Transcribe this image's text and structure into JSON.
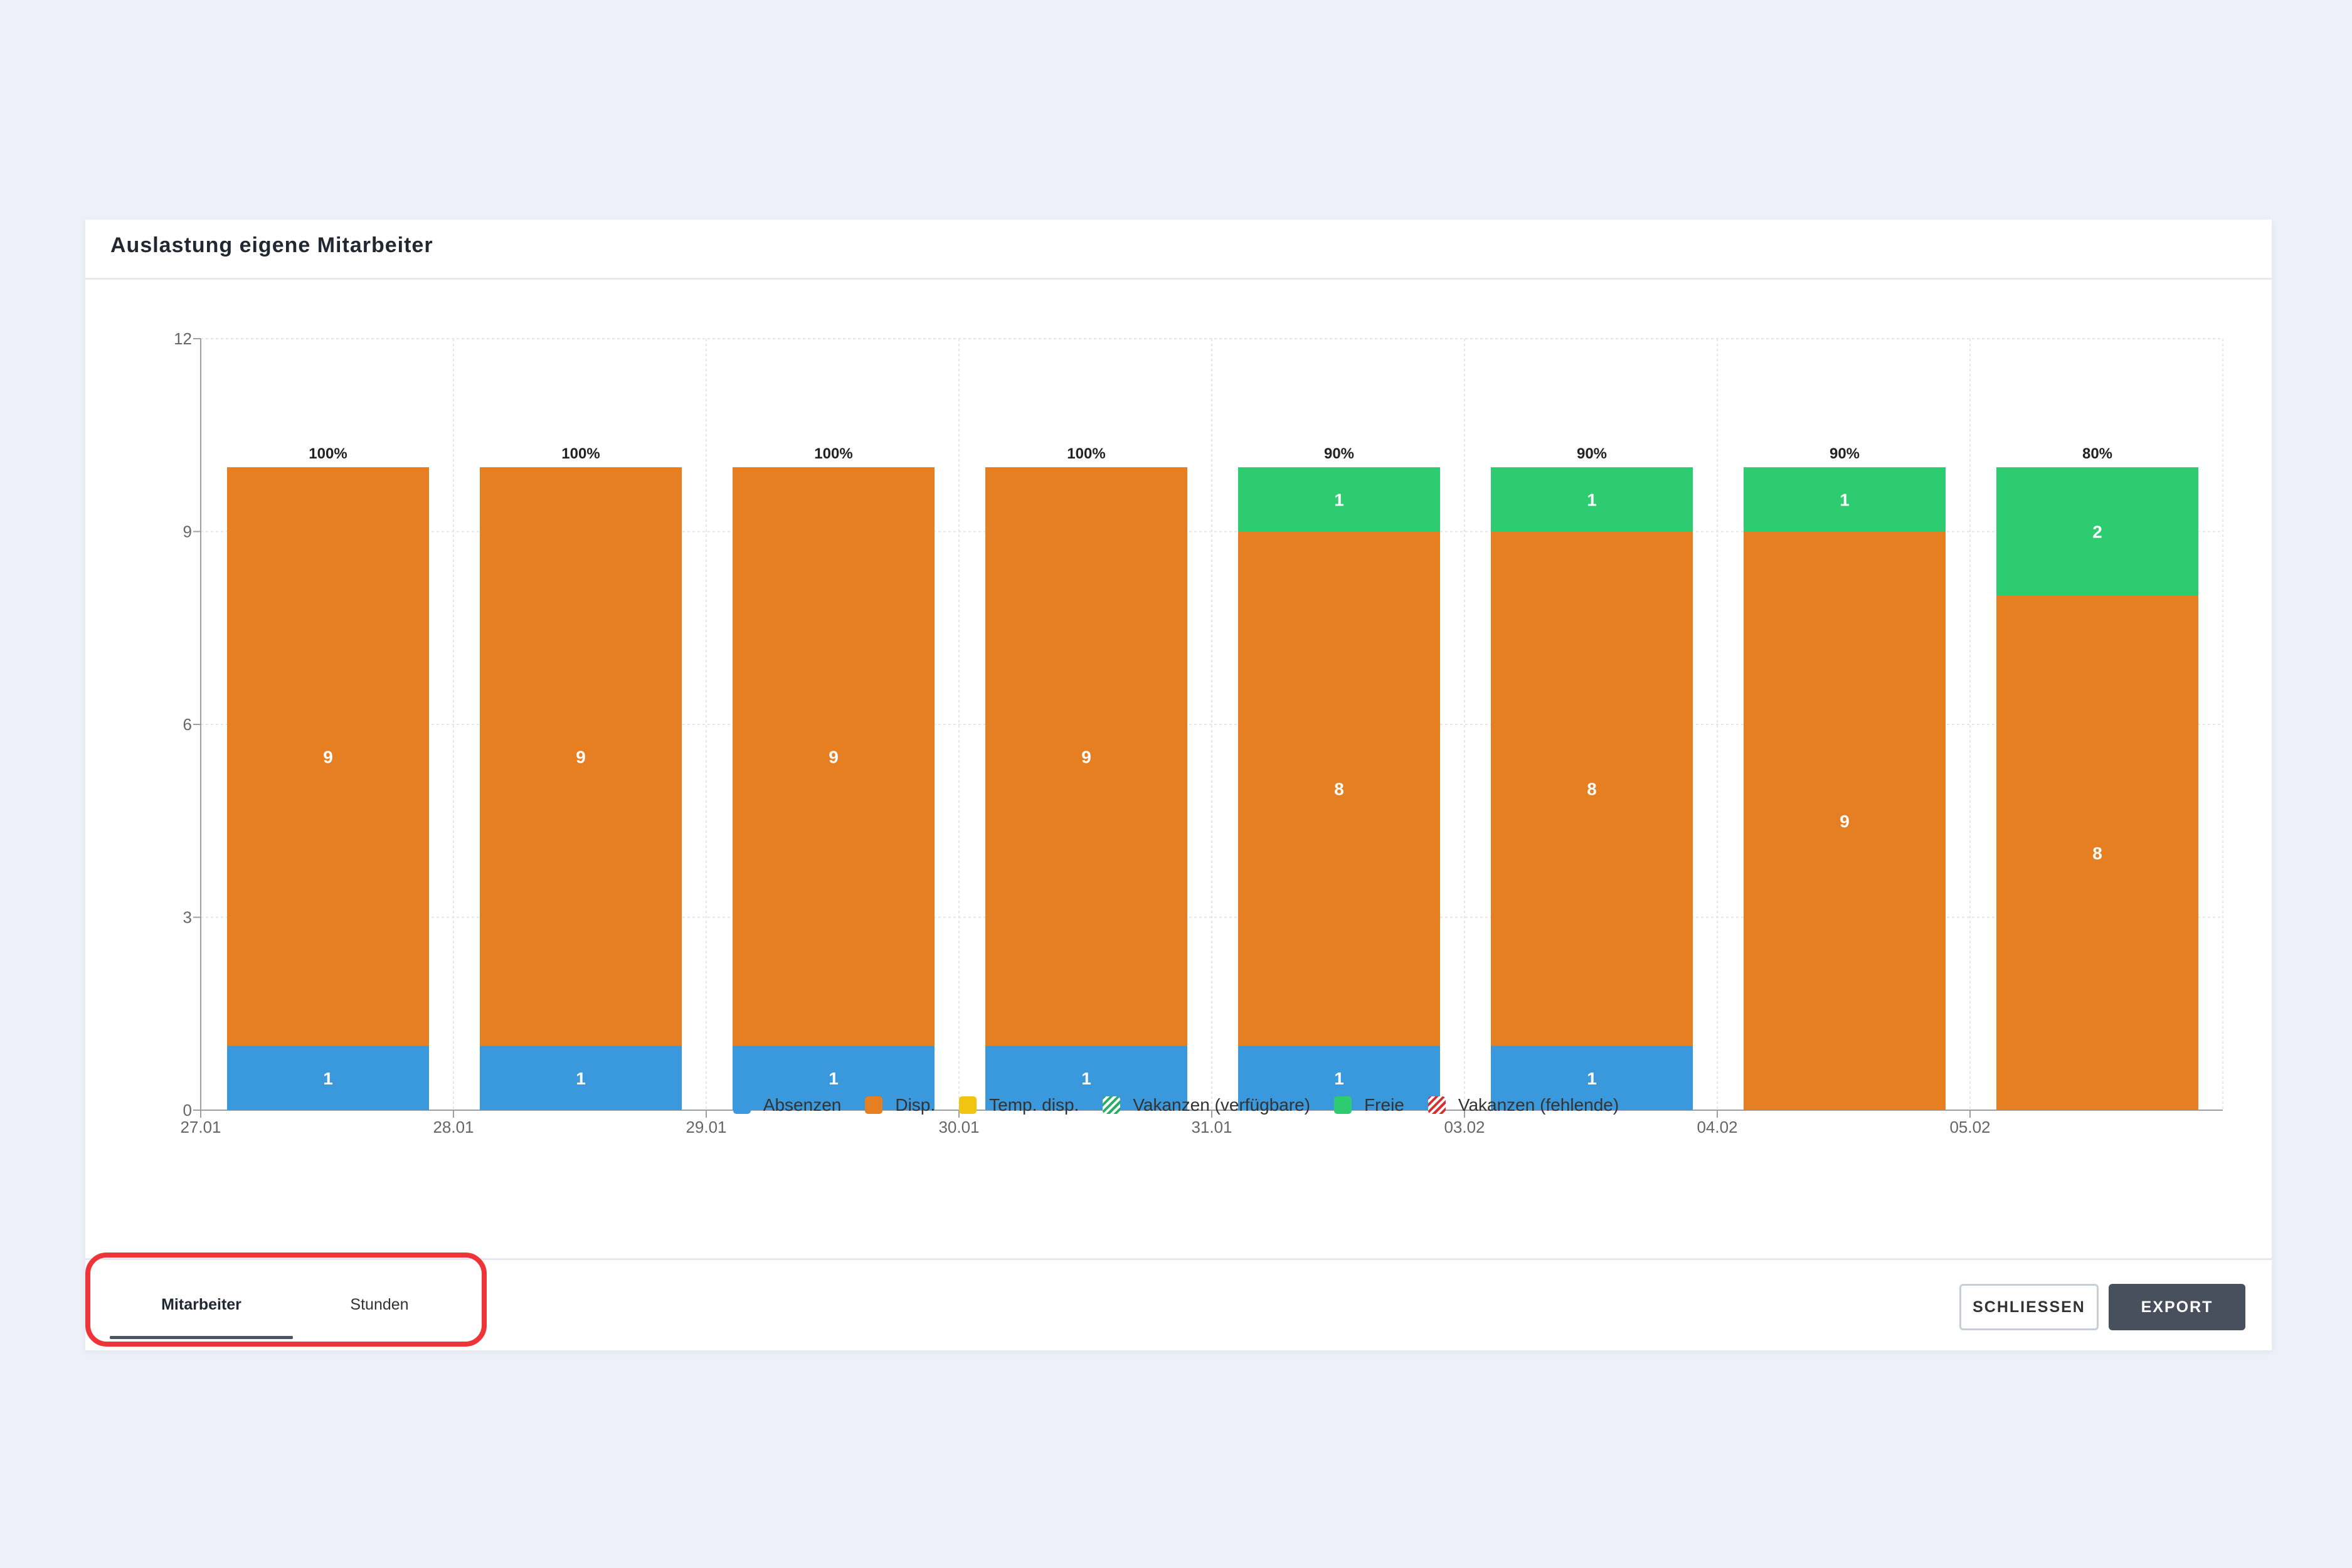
{
  "modal": {
    "title": "Auslastung eigene Mitarbeiter"
  },
  "footer": {
    "tabs": [
      {
        "label": "Mitarbeiter",
        "active": true
      },
      {
        "label": "Stunden",
        "active": false
      }
    ],
    "close_label": "SCHLIESSEN",
    "export_label": "EXPORT"
  },
  "colors": {
    "absenzen": "#3a99dc",
    "disp": "#e67e22",
    "temp_disp": "#f1c40f",
    "vakanzen_verfuegbare": "#27ae60",
    "freie": "#2ecc71",
    "vakanzen_fehlende": "#d63031"
  },
  "legend": [
    {
      "label": "Absenzen",
      "color": "#3a99dc",
      "pattern": "solid"
    },
    {
      "label": "Disp.",
      "color": "#e67e22",
      "pattern": "solid"
    },
    {
      "label": "Temp. disp.",
      "color": "#f1c40f",
      "pattern": "solid"
    },
    {
      "label": "Vakanzen (verfügbare)",
      "color": "#27ae60",
      "pattern": "hatched"
    },
    {
      "label": "Freie",
      "color": "#2ecc71",
      "pattern": "solid"
    },
    {
      "label": "Vakanzen (fehlende)",
      "color": "#d63031",
      "pattern": "hatched"
    }
  ],
  "chart_data": {
    "type": "bar",
    "stacked": true,
    "categories": [
      "27.01",
      "28.01",
      "29.01",
      "30.01",
      "31.01",
      "03.02",
      "04.02",
      "05.02"
    ],
    "x_tick_labels": [
      "27.01",
      "28.01",
      "29.01",
      "30.01",
      "31.01",
      "03.02",
      "04.02",
      "05.02"
    ],
    "y_ticks": [
      0,
      3,
      6,
      9,
      12
    ],
    "ylim": [
      0,
      12
    ],
    "grid": true,
    "legend_position": "bottom",
    "series": [
      {
        "name": "Absenzen",
        "color": "#3a99dc",
        "values": [
          1,
          1,
          1,
          1,
          1,
          1,
          0,
          0
        ]
      },
      {
        "name": "Disp.",
        "color": "#e67e22",
        "values": [
          9,
          9,
          9,
          9,
          8,
          8,
          9,
          8
        ]
      },
      {
        "name": "Temp. disp.",
        "color": "#f1c40f",
        "values": [
          0,
          0,
          0,
          0,
          0,
          0,
          0,
          0
        ]
      },
      {
        "name": "Vakanzen (verfügbare)",
        "color": "#27ae60",
        "values": [
          0,
          0,
          0,
          0,
          0,
          0,
          0,
          0
        ]
      },
      {
        "name": "Freie",
        "color": "#2ecc71",
        "values": [
          0,
          0,
          0,
          0,
          1,
          1,
          1,
          2
        ]
      },
      {
        "name": "Vakanzen (fehlende)",
        "color": "#d63031",
        "values": [
          0,
          0,
          0,
          0,
          0,
          0,
          0,
          0
        ]
      }
    ],
    "total_labels": [
      "100%",
      "100%",
      "100%",
      "100%",
      "90%",
      "90%",
      "90%",
      "80%"
    ]
  }
}
